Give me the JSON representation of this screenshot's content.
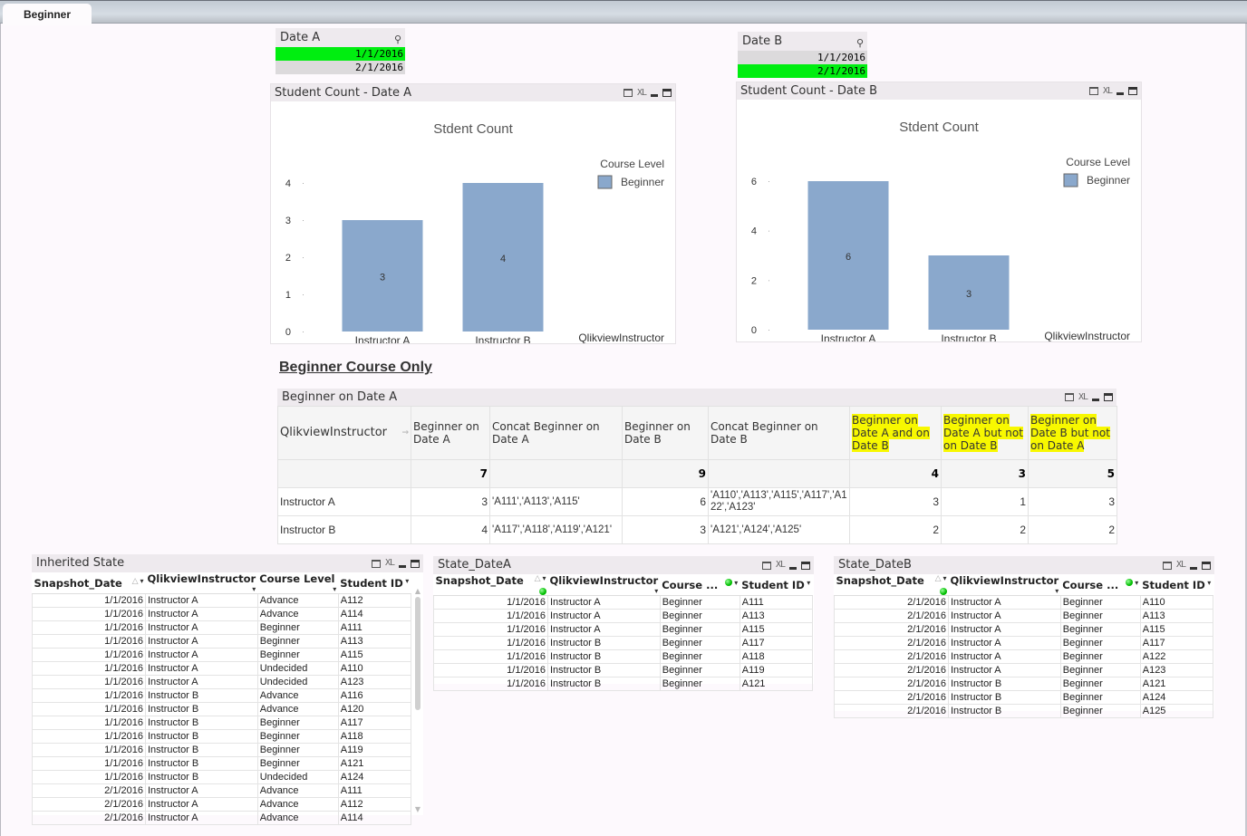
{
  "tabs": [
    {
      "label": "Beginner",
      "active": true
    }
  ],
  "listbox_a": {
    "title": "Date A",
    "items": [
      {
        "label": "1/1/2016",
        "selected": true
      },
      {
        "label": "2/1/2016",
        "selected": false
      }
    ]
  },
  "listbox_b": {
    "title": "Date B",
    "items": [
      {
        "label": "1/1/2016",
        "selected": false
      },
      {
        "label": "2/1/2016",
        "selected": true
      }
    ]
  },
  "window_controls": {
    "xl": "XL"
  },
  "colors": {
    "bar": "#8aa8cc",
    "selected": "#00ee10",
    "highlight": "#f8f800"
  },
  "chart_data": [
    {
      "type": "bar",
      "window_title": "Student Count - Date A",
      "title": "Stdent Count",
      "categories": [
        "Instructor A",
        "Instructor B"
      ],
      "series": [
        {
          "name": "Beginner",
          "values": [
            3,
            4
          ]
        }
      ],
      "xlabel": "QlikviewInstructor",
      "ylabel": "",
      "ylim": [
        0,
        4
      ],
      "yticks": [
        0,
        1,
        2,
        3,
        4
      ],
      "legend_title": "Course Level",
      "legend_position": "top-right",
      "data_labels": true,
      "grid": false
    },
    {
      "type": "bar",
      "window_title": "Student Count - Date B",
      "title": "Stdent Count",
      "categories": [
        "Instructor A",
        "Instructor B"
      ],
      "series": [
        {
          "name": "Beginner",
          "values": [
            6,
            3
          ]
        }
      ],
      "xlabel": "QlikviewInstructor",
      "ylabel": "",
      "ylim": [
        0,
        6
      ],
      "yticks": [
        0,
        2,
        4,
        6
      ],
      "legend_title": "Course Level",
      "legend_position": "top-right",
      "data_labels": true,
      "grid": false
    }
  ],
  "section_title": "Beginner Course Only",
  "summary_table": {
    "title": "Beginner on Date A",
    "headers": [
      "QlikviewInstructor",
      "Beginner on Date A",
      "Concat Beginner on Date A",
      "Beginner on Date B",
      "Concat Beginner on Date B",
      "Beginner on Date A and on Date B",
      "Beginner on Date A  but not on Date B",
      "Beginner on Date B but not on Date A"
    ],
    "totals": [
      "",
      "7",
      "",
      "9",
      "",
      "4",
      "3",
      "5"
    ],
    "rows": [
      [
        "Instructor A",
        "3",
        "'A111','A113','A115'",
        "6",
        "'A110','A113','A115','A117','A122','A123'",
        "3",
        "1",
        "3"
      ],
      [
        "Instructor B",
        "4",
        "'A117','A118','A119','A121'",
        "3",
        "'A121','A124','A125'",
        "2",
        "2",
        "2"
      ]
    ]
  },
  "inherited_state": {
    "title": "Inherited State",
    "headers": [
      "Snapshot_Date",
      "QlikviewInstructor",
      "Course Level",
      "Student ID"
    ],
    "rows": [
      [
        "1/1/2016",
        "Instructor A",
        "Advance",
        "A112"
      ],
      [
        "1/1/2016",
        "Instructor A",
        "Advance",
        "A114"
      ],
      [
        "1/1/2016",
        "Instructor A",
        "Beginner",
        "A111"
      ],
      [
        "1/1/2016",
        "Instructor A",
        "Beginner",
        "A113"
      ],
      [
        "1/1/2016",
        "Instructor A",
        "Beginner",
        "A115"
      ],
      [
        "1/1/2016",
        "Instructor A",
        "Undecided",
        "A110"
      ],
      [
        "1/1/2016",
        "Instructor A",
        "Undecided",
        "A123"
      ],
      [
        "1/1/2016",
        "Instructor B",
        "Advance",
        "A116"
      ],
      [
        "1/1/2016",
        "Instructor B",
        "Advance",
        "A120"
      ],
      [
        "1/1/2016",
        "Instructor B",
        "Beginner",
        "A117"
      ],
      [
        "1/1/2016",
        "Instructor B",
        "Beginner",
        "A118"
      ],
      [
        "1/1/2016",
        "Instructor B",
        "Beginner",
        "A119"
      ],
      [
        "1/1/2016",
        "Instructor B",
        "Beginner",
        "A121"
      ],
      [
        "1/1/2016",
        "Instructor B",
        "Undecided",
        "A124"
      ],
      [
        "2/1/2016",
        "Instructor A",
        "Advance",
        "A111"
      ],
      [
        "2/1/2016",
        "Instructor A",
        "Advance",
        "A112"
      ],
      [
        "2/1/2016",
        "Instructor A",
        "Advance",
        "A114"
      ]
    ]
  },
  "state_date_a": {
    "title": "State_DateA",
    "headers": [
      "Snapshot_Date",
      "QlikviewInstructor",
      "Course ...",
      "Student ID"
    ],
    "rows": [
      [
        "1/1/2016",
        "Instructor A",
        "Beginner",
        "A111"
      ],
      [
        "1/1/2016",
        "Instructor A",
        "Beginner",
        "A113"
      ],
      [
        "1/1/2016",
        "Instructor A",
        "Beginner",
        "A115"
      ],
      [
        "1/1/2016",
        "Instructor B",
        "Beginner",
        "A117"
      ],
      [
        "1/1/2016",
        "Instructor B",
        "Beginner",
        "A118"
      ],
      [
        "1/1/2016",
        "Instructor B",
        "Beginner",
        "A119"
      ],
      [
        "1/1/2016",
        "Instructor B",
        "Beginner",
        "A121"
      ]
    ]
  },
  "state_date_b": {
    "title": "State_DateB",
    "headers": [
      "Snapshot_Date",
      "QlikviewInstructor",
      "Course ...",
      "Student ID"
    ],
    "rows": [
      [
        "2/1/2016",
        "Instructor A",
        "Beginner",
        "A110"
      ],
      [
        "2/1/2016",
        "Instructor A",
        "Beginner",
        "A113"
      ],
      [
        "2/1/2016",
        "Instructor A",
        "Beginner",
        "A115"
      ],
      [
        "2/1/2016",
        "Instructor A",
        "Beginner",
        "A117"
      ],
      [
        "2/1/2016",
        "Instructor A",
        "Beginner",
        "A122"
      ],
      [
        "2/1/2016",
        "Instructor A",
        "Beginner",
        "A123"
      ],
      [
        "2/1/2016",
        "Instructor B",
        "Beginner",
        "A121"
      ],
      [
        "2/1/2016",
        "Instructor B",
        "Beginner",
        "A124"
      ],
      [
        "2/1/2016",
        "Instructor B",
        "Beginner",
        "A125"
      ]
    ]
  }
}
